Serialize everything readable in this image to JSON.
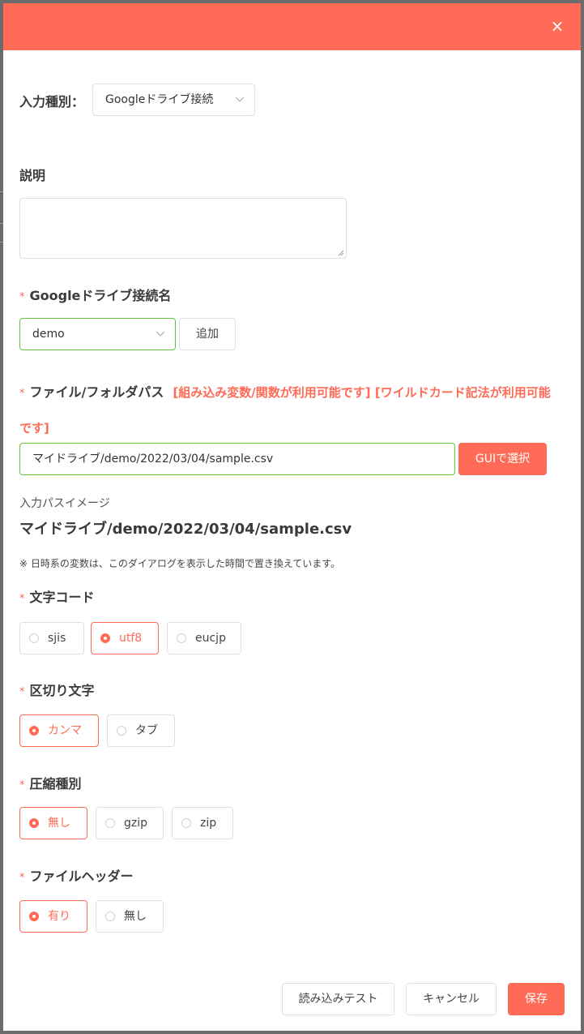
{
  "header": {
    "close_label": "×",
    "accent": "#ff6b57"
  },
  "input_type": {
    "label": "入力種別：",
    "value": "Googleドライブ接続"
  },
  "description": {
    "label": "説明",
    "value": ""
  },
  "connection": {
    "required_mark": "*",
    "label": "Googleドライブ接続名",
    "value": "demo",
    "add_label": "追加"
  },
  "path": {
    "required_mark": "*",
    "label": "ファイル/フォルダパス",
    "note_line1": "[組み込み変数/関数が利用可能です] [ワイルドカード記法が利用可能",
    "note_line2": "です]",
    "value": "マイドライブ/demo/2022/03/04/sample.csv",
    "gui_label": "GUIで選択"
  },
  "preview": {
    "label": "入力パスイメージ",
    "value": "マイドライブ/demo/2022/03/04/sample.csv",
    "note": "※ 日時系の変数は、このダイアログを表示した時間で置き換えています。"
  },
  "encoding": {
    "required_mark": "*",
    "label": "文字コード",
    "options": [
      {
        "label": "sjis",
        "checked": false
      },
      {
        "label": "utf8",
        "checked": true
      },
      {
        "label": "eucjp",
        "checked": false
      }
    ]
  },
  "delimiter": {
    "required_mark": "*",
    "label": "区切り文字",
    "options": [
      {
        "label": "カンマ",
        "checked": true
      },
      {
        "label": "タブ",
        "checked": false
      }
    ]
  },
  "compression": {
    "required_mark": "*",
    "label": "圧縮種別",
    "options": [
      {
        "label": "無し",
        "checked": true
      },
      {
        "label": "gzip",
        "checked": false
      },
      {
        "label": "zip",
        "checked": false
      }
    ]
  },
  "header_row": {
    "required_mark": "*",
    "label": "ファイルヘッダー",
    "options": [
      {
        "label": "有り",
        "checked": true
      },
      {
        "label": "無し",
        "checked": false
      }
    ]
  },
  "footer": {
    "test_label": "読み込みテスト",
    "cancel_label": "キャンセル",
    "save_label": "保存"
  }
}
